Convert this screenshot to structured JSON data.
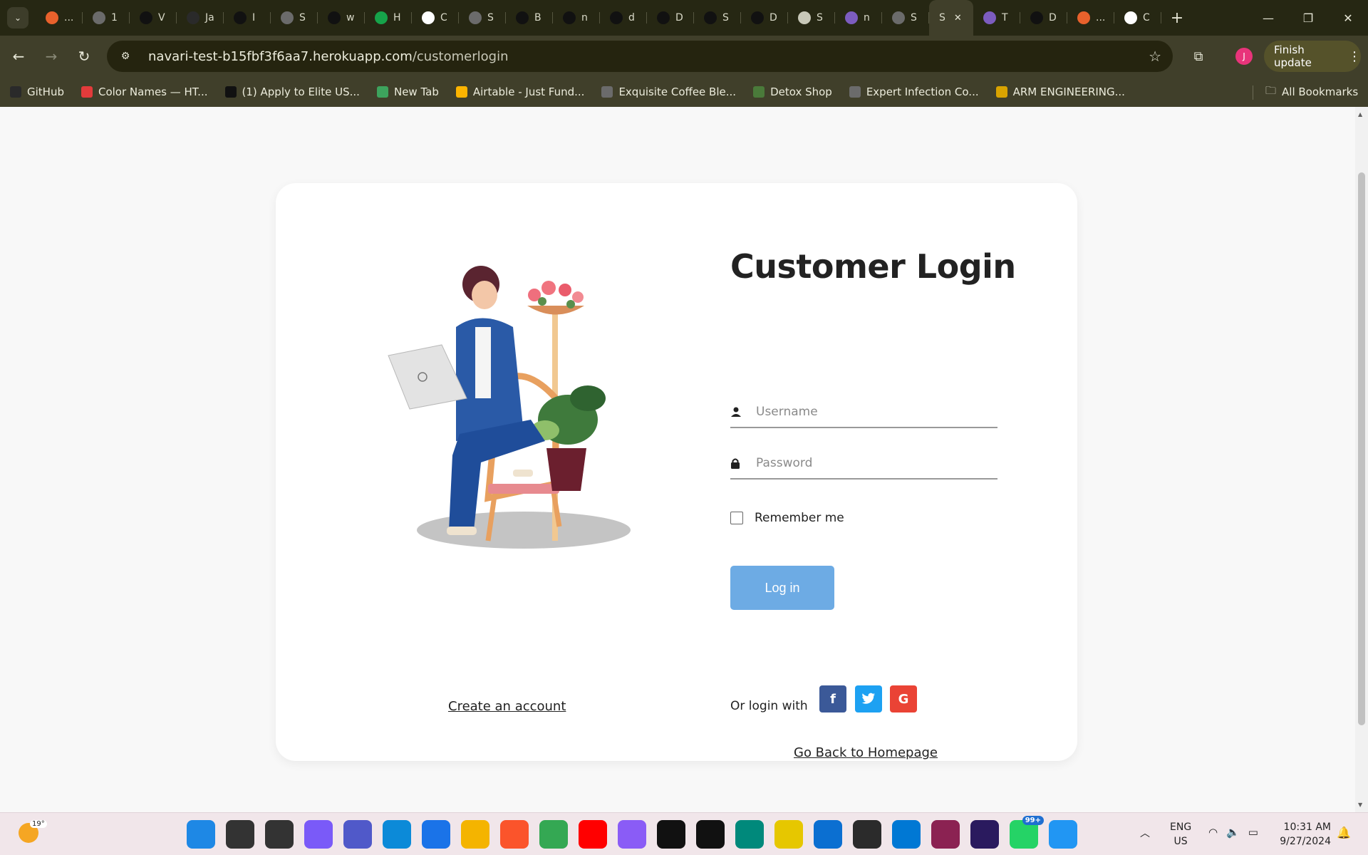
{
  "browser": {
    "tabs": [
      {
        "label": "...",
        "icon": "box-icon",
        "color": "#e8612c"
      },
      {
        "label": "1",
        "icon": "globe-icon",
        "color": "#6b6b6b"
      },
      {
        "label": "V",
        "icon": "triangle-icon",
        "color": "#111111"
      },
      {
        "label": "Ja",
        "icon": "github-icon",
        "color": "#2a2a2a"
      },
      {
        "label": "I",
        "icon": "dots-icon",
        "color": "#111111"
      },
      {
        "label": "S",
        "icon": "globe-icon",
        "color": "#6b6b6b"
      },
      {
        "label": "w",
        "icon": "tiktok-icon",
        "color": "#111111"
      },
      {
        "label": "H",
        "icon": "infinity-icon",
        "color": "#16a34a"
      },
      {
        "label": "C",
        "icon": "chatgpt-icon",
        "color": "#ffffff"
      },
      {
        "label": "S",
        "icon": "globe-icon",
        "color": "#6b6b6b"
      },
      {
        "label": "B",
        "icon": "tiktok-icon",
        "color": "#111111"
      },
      {
        "label": "n",
        "icon": "tiktok-icon",
        "color": "#111111"
      },
      {
        "label": "d",
        "icon": "tiktok-icon",
        "color": "#111111"
      },
      {
        "label": "D",
        "icon": "tiktok-icon",
        "color": "#111111"
      },
      {
        "label": "S",
        "icon": "e-icon",
        "color": "#111111"
      },
      {
        "label": "D",
        "icon": "tiktok-icon",
        "color": "#111111"
      },
      {
        "label": "S",
        "icon": "gear-icon",
        "color": "#c8c8b8"
      },
      {
        "label": "n",
        "icon": "h-icon",
        "color": "#7c5cbf"
      },
      {
        "label": "S",
        "icon": "globe-icon",
        "color": "#6b6b6b"
      },
      {
        "label": "S",
        "icon": "none",
        "color": "#403f2a",
        "active": true
      },
      {
        "label": "T",
        "icon": "h-icon",
        "color": "#7c5cbf"
      },
      {
        "label": "D",
        "icon": "mc-icon",
        "color": "#111111"
      },
      {
        "label": "...",
        "icon": "box-icon",
        "color": "#e8612c"
      },
      {
        "label": "C",
        "icon": "chatgpt-icon",
        "color": "#ffffff"
      }
    ],
    "url_host": "navari-test-b15fbf3f6aa7.herokuapp.com",
    "url_path": "/customerlogin",
    "profile_initial": "J",
    "finish_update": "Finish update",
    "bookmarks": [
      {
        "label": "GitHub",
        "icon": "github-icon",
        "color": "#2a2a2a"
      },
      {
        "label": "Color Names — HT...",
        "icon": "colornames-icon",
        "color": "#e33b3b"
      },
      {
        "label": "(1) Apply to Elite US...",
        "icon": "elite-icon",
        "color": "#111111"
      },
      {
        "label": "New Tab",
        "icon": "newtab-icon",
        "color": "#3da35d"
      },
      {
        "label": "Airtable - Just Fund...",
        "icon": "airtable-icon",
        "color": "#fcb400"
      },
      {
        "label": "Exquisite Coffee Ble...",
        "icon": "globe-icon",
        "color": "#6b6b6b"
      },
      {
        "label": "Detox Shop",
        "icon": "detox-icon",
        "color": "#4a7a3a"
      },
      {
        "label": "Expert Infection Co...",
        "icon": "globe-icon",
        "color": "#6b6b6b"
      },
      {
        "label": "ARM ENGINEERING...",
        "icon": "arm-icon",
        "color": "#d9a300"
      }
    ],
    "all_bookmarks": "All Bookmarks"
  },
  "login": {
    "title": "Customer Login",
    "username_placeholder": "Username",
    "password_placeholder": "Password",
    "remember_label": "Remember me",
    "login_button": "Log in",
    "create_account": "Create an account",
    "or_login_with": "Or login with",
    "social": [
      {
        "name": "facebook",
        "glyph": "f",
        "color": "#3b5998"
      },
      {
        "name": "twitter",
        "glyph": "t",
        "color": "#1da1f2"
      },
      {
        "name": "google",
        "glyph": "G",
        "color": "#ea4335"
      }
    ],
    "back_home": "Go Back to Homepage",
    "button_color": "#6dabe4"
  },
  "taskbar": {
    "weather_temp": "19°",
    "apps": [
      {
        "name": "windows-start",
        "color": "#1e88e5"
      },
      {
        "name": "search",
        "color": "#333333"
      },
      {
        "name": "task-view",
        "color": "#333333"
      },
      {
        "name": "copilot",
        "color": "#7a5af8"
      },
      {
        "name": "teams",
        "color": "#5059c9"
      },
      {
        "name": "edge",
        "color": "#0c8ad8"
      },
      {
        "name": "store",
        "color": "#1a73e8"
      },
      {
        "name": "file-explorer",
        "color": "#f4b400"
      },
      {
        "name": "brave",
        "color": "#fb542b"
      },
      {
        "name": "chrome",
        "color": "#34a853"
      },
      {
        "name": "youtube",
        "color": "#ff0000"
      },
      {
        "name": "app-purple",
        "color": "#8a5cf6"
      },
      {
        "name": "tick-app",
        "color": "#111111"
      },
      {
        "name": "github-desktop",
        "color": "#111111"
      },
      {
        "name": "meet",
        "color": "#00897b"
      },
      {
        "name": "sticky-notes",
        "color": "#e6c700"
      },
      {
        "name": "quick-assist",
        "color": "#0b6fd1"
      },
      {
        "name": "terminal",
        "color": "#2b2b2b"
      },
      {
        "name": "vscode",
        "color": "#0078d4"
      },
      {
        "name": "winrar",
        "color": "#8b2252"
      },
      {
        "name": "premiere",
        "color": "#2a1a5e"
      },
      {
        "name": "whatsapp",
        "color": "#25d366",
        "badge": "99+"
      },
      {
        "name": "photos",
        "color": "#2196f3"
      }
    ],
    "lang_top": "ENG",
    "lang_bottom": "US",
    "time": "10:31 AM",
    "date": "9/27/2024"
  }
}
